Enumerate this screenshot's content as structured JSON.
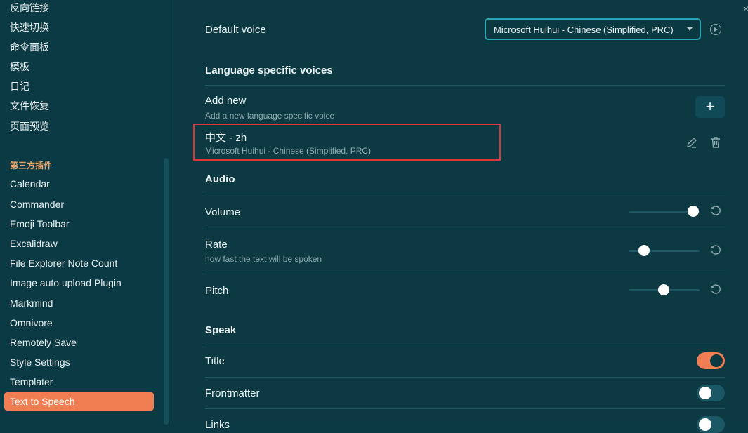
{
  "sidebar": {
    "core_items": [
      "反向链接",
      "快速切换",
      "命令面板",
      "模板",
      "日记",
      "文件恢复",
      "页面预览"
    ],
    "section_title": "第三方插件",
    "plugins": [
      "Calendar",
      "Commander",
      "Emoji Toolbar",
      "Excalidraw",
      "File Explorer Note Count",
      "Image auto upload Plugin",
      "Markmind",
      "Omnivore",
      "Remotely Save",
      "Style Settings",
      "Templater"
    ],
    "active_item": "Text to Speech"
  },
  "settings": {
    "default_voice": {
      "label": "Default voice",
      "value": "Microsoft Huihui - Chinese (Simplified, PRC)"
    },
    "language_section": "Language specific voices",
    "add_new": {
      "label": "Add new",
      "desc": "Add a new language specific voice",
      "button": "+"
    },
    "language_voice": {
      "label": "中文 - zh",
      "desc": "Microsoft Huihui - Chinese (Simplified, PRC)"
    },
    "audio_section": "Audio",
    "volume": {
      "label": "Volume",
      "value": 1.0
    },
    "rate": {
      "label": "Rate",
      "desc": "how fast the text will be spoken",
      "value": 0.17
    },
    "pitch": {
      "label": "Pitch",
      "value": 0.5
    },
    "speak_section": "Speak",
    "title": {
      "label": "Title",
      "enabled": true
    },
    "frontmatter": {
      "label": "Frontmatter",
      "enabled": false
    },
    "links": {
      "label": "Links",
      "enabled": false
    }
  },
  "colors": {
    "accent": "#f07e52",
    "background": "#0b3a44",
    "highlight": "#e0333a"
  }
}
